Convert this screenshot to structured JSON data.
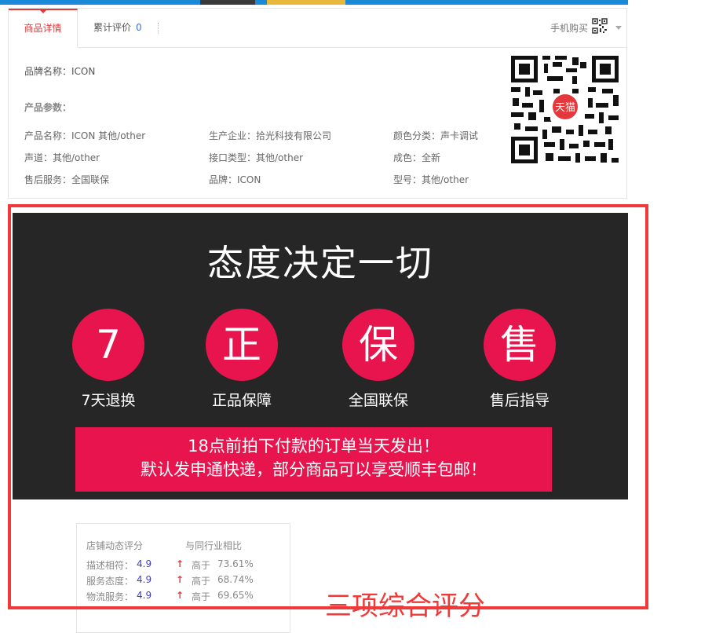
{
  "tabs": {
    "details_label": "商品详情",
    "reviews_label": "累计评价",
    "reviews_count": "0",
    "mobile_buy_label": "手机购买"
  },
  "brand": {
    "label": "品牌名称：",
    "value": "ICON"
  },
  "params": {
    "title": "产品参数：",
    "items": [
      "产品名称：ICON 其他/other",
      "生产企业：拾光科技有限公司",
      "颜色分类：声卡调试",
      "声道：其他/other",
      "接口类型：其他/other",
      "成色：全新",
      "售后服务：全国联保",
      "品牌：ICON",
      "型号：其他/other"
    ]
  },
  "qr": {
    "badge": "天猫"
  },
  "promo": {
    "headline": "态度决定一切",
    "features": [
      {
        "glyph": "7",
        "label": "7天退换"
      },
      {
        "glyph": "正",
        "label": "正品保障"
      },
      {
        "glyph": "保",
        "label": "全国联保"
      },
      {
        "glyph": "售",
        "label": "售后指导"
      }
    ],
    "notice_line1": "18点前拍下付款的订单当天发出！",
    "notice_line2": "默认发申通快递，部分商品可以享受顺丰包邮！",
    "colors": {
      "background": "#262626",
      "accent": "#e8144e"
    }
  },
  "rating": {
    "header_left": "店铺动态评分",
    "header_right": "与同行业相比",
    "rows": [
      {
        "label": "描述相符：",
        "score": "4.9",
        "arrow": "↑",
        "compare": "高于",
        "percent": "73.61%"
      },
      {
        "label": "服务态度：",
        "score": "4.9",
        "arrow": "↑",
        "compare": "高于",
        "percent": "68.74%"
      },
      {
        "label": "物流服务：",
        "score": "4.9",
        "arrow": "↑",
        "compare": "高于",
        "percent": "69.65%"
      }
    ]
  },
  "annotation": {
    "text": "三项综合评分",
    "color": "#f03a3a"
  }
}
